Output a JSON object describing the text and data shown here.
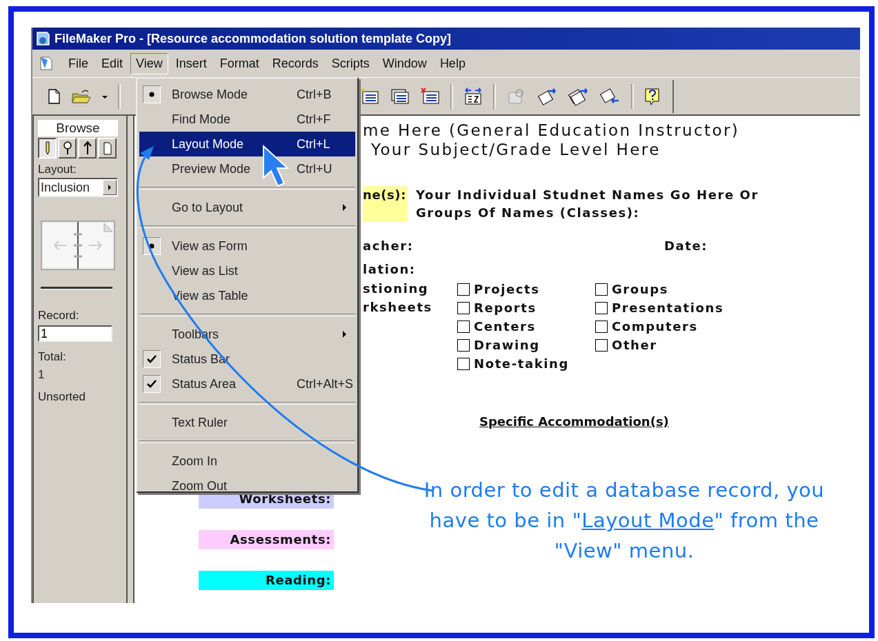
{
  "window": {
    "title": "FileMaker Pro - [Resource accommodation solution template Copy]"
  },
  "menubar": [
    {
      "label": "File",
      "selected": false
    },
    {
      "label": "Edit",
      "selected": false
    },
    {
      "label": "View",
      "selected": true
    },
    {
      "label": "Insert",
      "selected": false
    },
    {
      "label": "Format",
      "selected": false
    },
    {
      "label": "Records",
      "selected": false
    },
    {
      "label": "Scripts",
      "selected": false
    },
    {
      "label": "Window",
      "selected": false
    },
    {
      "label": "Help",
      "selected": false
    }
  ],
  "status_area": {
    "mode_tab": "Browse",
    "modes": [
      {
        "kind": "pencil",
        "selected": true
      },
      {
        "kind": "magnifier",
        "selected": false
      },
      {
        "kind": "tsquare",
        "selected": false
      },
      {
        "kind": "page",
        "selected": false
      }
    ],
    "layout_label": "Layout:",
    "layout_value": "Inclusion",
    "record_label": "Record:",
    "record_value": "1",
    "total_label": "Total:",
    "total_value": "1",
    "sort_status": "Unsorted"
  },
  "view_menu": [
    {
      "kind": "item",
      "label": "Browse Mode",
      "shortcut": "Ctrl+B",
      "bullet": true,
      "checked": false,
      "selected": false
    },
    {
      "kind": "item",
      "label": "Find Mode",
      "shortcut": "Ctrl+F",
      "bullet": false,
      "checked": false,
      "selected": false
    },
    {
      "kind": "item",
      "label": "Layout Mode",
      "shortcut": "Ctrl+L",
      "bullet": false,
      "checked": false,
      "selected": true
    },
    {
      "kind": "item",
      "label": "Preview Mode",
      "shortcut": "Ctrl+U",
      "bullet": false,
      "checked": false,
      "selected": false
    },
    {
      "kind": "separator"
    },
    {
      "kind": "submenu",
      "label": "Go to Layout",
      "bullet": false,
      "checked": false,
      "selected": false
    },
    {
      "kind": "separator"
    },
    {
      "kind": "item",
      "label": "View as Form",
      "bullet": true,
      "checked": false,
      "selected": false
    },
    {
      "kind": "item",
      "label": "View as List",
      "bullet": false,
      "checked": false,
      "selected": false
    },
    {
      "kind": "item",
      "label": "View as Table",
      "bullet": false,
      "checked": false,
      "selected": false
    },
    {
      "kind": "separator"
    },
    {
      "kind": "submenu",
      "label": "Toolbars",
      "bullet": false,
      "checked": false,
      "selected": false
    },
    {
      "kind": "item",
      "label": "Status Bar",
      "bullet": false,
      "checked": true,
      "selected": false
    },
    {
      "kind": "item",
      "label": "Status Area",
      "shortcut": "Ctrl+Alt+S",
      "bullet": false,
      "checked": true,
      "selected": false
    },
    {
      "kind": "separator"
    },
    {
      "kind": "item",
      "label": "Text Ruler",
      "bullet": false,
      "checked": false,
      "selected": false
    },
    {
      "kind": "separator"
    },
    {
      "kind": "item",
      "label": "Zoom In",
      "bullet": false,
      "checked": false,
      "selected": false
    },
    {
      "kind": "item",
      "label": "Zoom Out",
      "bullet": false,
      "checked": false,
      "selected": false
    }
  ],
  "form": {
    "heading_lines": [
      "me Here (General Education Instructor)",
      "Your Subject/Grade Level Here"
    ],
    "names_label": "ne(s):",
    "names_lines": [
      "Your Individual Studnet Names Go Here Or",
      "Groups Of Names (Classes):"
    ],
    "teacher_label": "acher:",
    "date_label": "Date:",
    "accommodation_label": "lation:",
    "left_options": [
      "stioning",
      "rksheets"
    ],
    "checkbox_columns": [
      [
        {
          "label": "Projects",
          "checked": false
        },
        {
          "label": "Reports",
          "checked": false
        },
        {
          "label": "Centers",
          "checked": false
        },
        {
          "label": "Drawing",
          "checked": false
        },
        {
          "label": "Note-taking",
          "checked": false
        }
      ],
      [
        {
          "label": "Groups",
          "checked": false
        },
        {
          "label": "Presentations",
          "checked": false
        },
        {
          "label": "Computers",
          "checked": false
        },
        {
          "label": "Other",
          "checked": false
        }
      ]
    ],
    "section_heading": "Specific Accommodation(s)",
    "subject_labels": [
      {
        "label": "Worksheets:",
        "color": "#ccccff"
      },
      {
        "label": "Assessments:",
        "color": "#ffccff"
      },
      {
        "label": "Reading:",
        "color": "#00ffff"
      }
    ]
  },
  "callout": {
    "before": "In order to edit a database record, you have to be in \"",
    "link": "Layout Mode",
    "after": "\" from the \"View\" menu."
  }
}
